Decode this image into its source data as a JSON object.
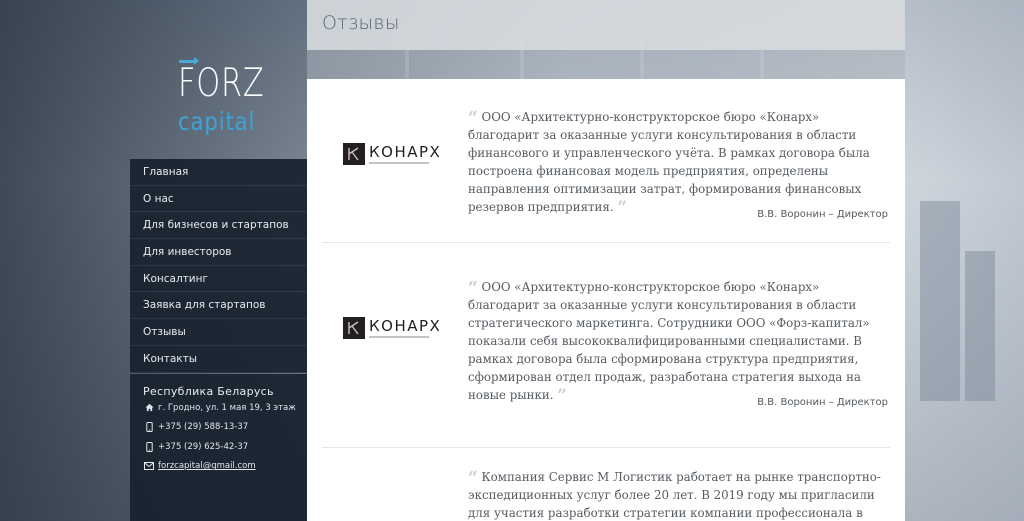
{
  "header": {
    "title": "Отзывы"
  },
  "logo": {
    "top": "FORZ",
    "bottom": "capital"
  },
  "nav": {
    "items": [
      "Главная",
      "О нас",
      "Для бизнесов и стартапов",
      "Для инвесторов",
      "Консалтинг",
      "Заявка для стартапов",
      "Отзывы",
      "Контакты"
    ]
  },
  "contacts": {
    "country": "Республика Беларусь",
    "address": "г. Гродно, ул. 1 мая 19, 3 этаж",
    "phone1": "+375 (29) 588-13-37",
    "phone2": "+375 (29) 625-42-37",
    "email": "forzcapital@gmail.com"
  },
  "reviews": [
    {
      "logo": "КОНАРХ",
      "text": "ООО «Архитектурно-конструкторское бюро «Конарх» благодарит за оказанные услуги консультирования в области финансового и управленческого учёта. В рамках договора была построена финансовая модель предприятия, определены направления оптимизации затрат, формирования финансовых резервов предприятия.",
      "author": "В.В. Воронин – Директор"
    },
    {
      "logo": "КОНАРХ",
      "text": "ООО «Архитектурно-конструкторское бюро «Конарх» благодарит за оказанные услуги консультирования в области стратегического маркетинга. Сотрудники ООО «Форз-капитал» показали себя высококвалифицированными специалистами. В рамках договора была сформирована структура предприятия, сформирован отдел продаж, разработана стратегия выхода на новые рынки.",
      "author": "В.В. Воронин – Директор"
    },
    {
      "text": "Компания Сервис М Логистик работает на рынке транспортно-экспедиционных услуг более 20 лет. В 2019 году мы пригласили для участия разработки стратегии компании профессионала в области"
    }
  ],
  "icons": {
    "address": "home-icon",
    "phone": "mobile-phone-icon",
    "email": "envelope-icon",
    "quote_open": "quote-open-icon",
    "quote_close": "quote-close-icon"
  },
  "colors": {
    "accent": "#3ea2d8",
    "sidebar": "#18222e",
    "text": "#555b61"
  }
}
